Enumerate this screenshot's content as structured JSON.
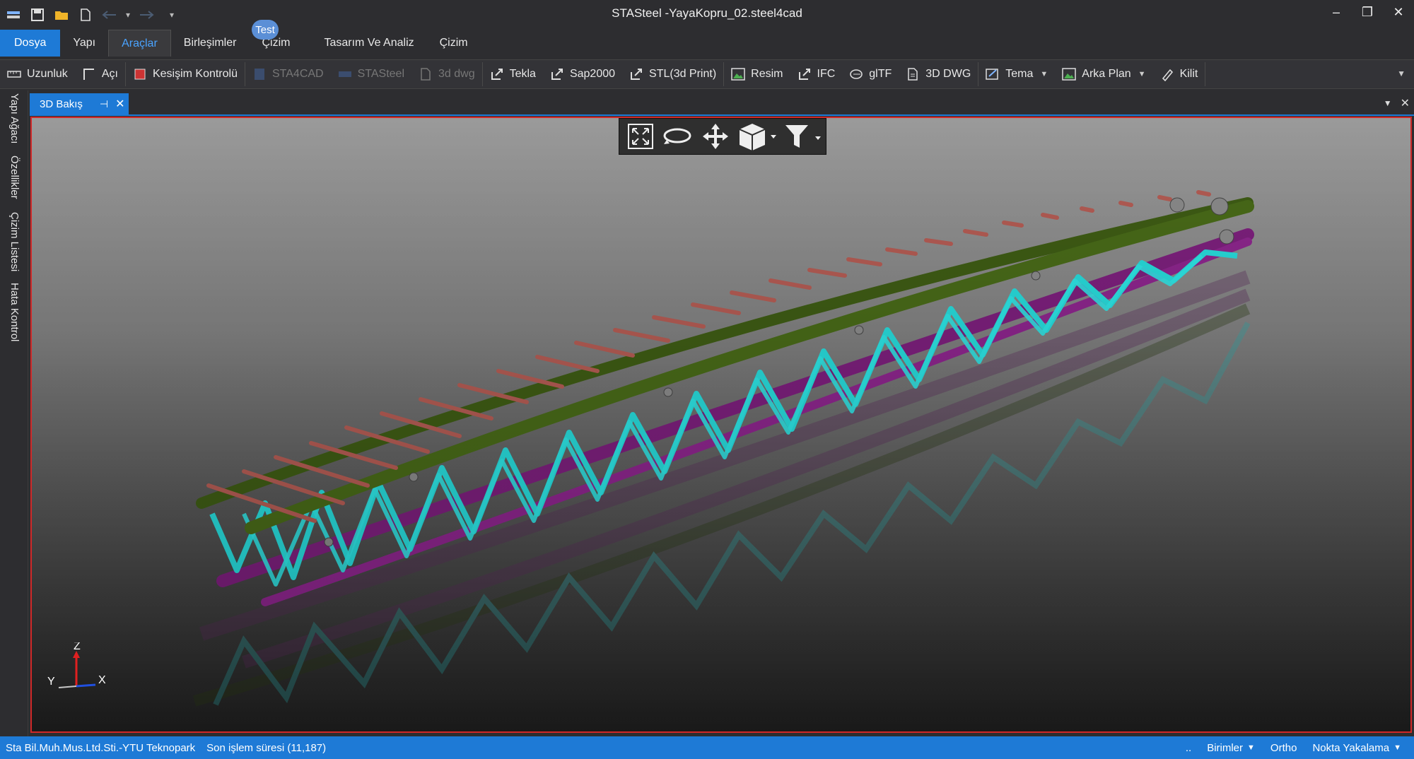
{
  "window": {
    "title": "STASteel -YayaKopru_02.steel4cad",
    "minimize_icon": "minimize-icon",
    "restore_icon": "restore-icon",
    "close_icon": "close-icon"
  },
  "quick_access": {
    "items": [
      "app-menu-icon",
      "save-icon",
      "open-folder-icon",
      "new-file-icon",
      "undo-icon",
      "redo-icon",
      "customize-icon"
    ]
  },
  "ribbon": {
    "tabs": [
      {
        "label": "Dosya"
      },
      {
        "label": "Yapı"
      },
      {
        "label": "Araçlar"
      },
      {
        "label": "Birleşimler"
      },
      {
        "label": "Çizim"
      },
      {
        "label": "Tasarım Ve Analiz"
      },
      {
        "label": "Çizim"
      }
    ],
    "badge": "Test"
  },
  "toolbar": {
    "items": [
      {
        "label": "Uzunluk",
        "icon": "ruler-icon"
      },
      {
        "label": "Açı",
        "icon": "angle-icon"
      },
      {
        "label": "Kesişim Kontrolü",
        "icon": "clash-check-icon"
      },
      {
        "label": "STA4CAD",
        "icon": "sta4cad-icon"
      },
      {
        "label": "STASteel",
        "icon": "stasteel-icon"
      },
      {
        "label": "3d dwg",
        "icon": "dwg-file-icon"
      },
      {
        "label": "Tekla",
        "icon": "export-icon"
      },
      {
        "label": "Sap2000",
        "icon": "export-icon"
      },
      {
        "label": "STL(3d Print)",
        "icon": "export-icon"
      },
      {
        "label": "Resim",
        "icon": "image-icon"
      },
      {
        "label": "IFC",
        "icon": "export-icon"
      },
      {
        "label": "glTF",
        "icon": "gltf-icon"
      },
      {
        "label": "3D DWG",
        "icon": "dwg-file-icon"
      },
      {
        "label": "Tema",
        "icon": "theme-icon"
      },
      {
        "label": "Arka Plan",
        "icon": "background-icon"
      },
      {
        "label": "Kilit",
        "icon": "lock-icon"
      }
    ]
  },
  "side_panel": {
    "tabs": [
      "Yapı Ağacı",
      "Özellikler",
      "Çizim Listesi",
      "Hata Kontrol"
    ]
  },
  "document": {
    "tab_label": "3D Bakış",
    "view_tools": [
      "zoom-extents-icon",
      "orbit-icon",
      "pan-icon",
      "view-cube-icon",
      "filter-icon"
    ],
    "axes": {
      "z": "Z",
      "y": "Y",
      "x": "X"
    },
    "colors": {
      "top_chord": "#3d5a14",
      "bottom_chord": "#7a1f7a",
      "diagonals": "#27d6d6",
      "deck_beams": "#b05a52"
    }
  },
  "status": {
    "company": "Sta Bil.Muh.Mus.Ltd.Sti.-YTU Teknopark",
    "last_op": "Son işlem süresi (11,187)",
    "dots": "..",
    "units": "Birimler",
    "ortho": "Ortho",
    "snap": "Nokta Yakalama"
  }
}
